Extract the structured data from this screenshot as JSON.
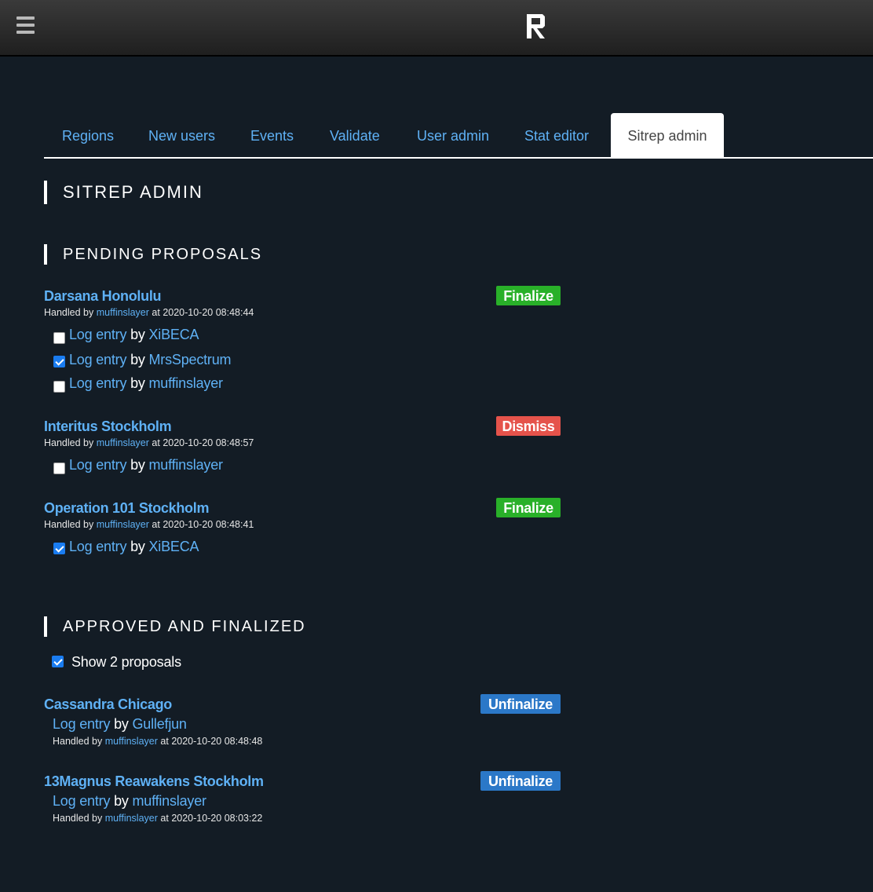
{
  "header": {
    "menu_icon": "hamburger-menu-icon",
    "logo_icon": "r-logo-icon"
  },
  "tabs": [
    {
      "label": "Regions"
    },
    {
      "label": "New users"
    },
    {
      "label": "Events"
    },
    {
      "label": "Validate"
    },
    {
      "label": "User admin"
    },
    {
      "label": "Stat editor"
    },
    {
      "label": "Sitrep admin",
      "active": true
    }
  ],
  "page_title": "SITREP ADMIN",
  "pending": {
    "heading": "PENDING PROPOSALS",
    "handled_by_prefix": "Handled by",
    "at_text": "at",
    "log_entry_label": "Log entry",
    "by_text": "by",
    "items": [
      {
        "title": "Darsana Honolulu",
        "handler": "muffinslayer",
        "timestamp": "2020-10-20 08:48:44",
        "action": "Finalize",
        "entries": [
          {
            "author": "XiBECA",
            "checked": false
          },
          {
            "author": "MrsSpectrum",
            "checked": true
          },
          {
            "author": "muffinslayer",
            "checked": false
          }
        ]
      },
      {
        "title": "Interitus Stockholm",
        "handler": "muffinslayer",
        "timestamp": "2020-10-20 08:48:57",
        "action": "Dismiss",
        "entries": [
          {
            "author": "muffinslayer",
            "checked": false
          }
        ]
      },
      {
        "title": "Operation 101 Stockholm",
        "handler": "muffinslayer",
        "timestamp": "2020-10-20 08:48:41",
        "action": "Finalize",
        "entries": [
          {
            "author": "XiBECA",
            "checked": true
          }
        ]
      }
    ]
  },
  "approved": {
    "heading": "APPROVED AND FINALIZED",
    "show_label": "Show 2 proposals",
    "show_checked": true,
    "items": [
      {
        "title": "Cassandra Chicago",
        "entry_author": "Gullefjun",
        "handler": "muffinslayer",
        "timestamp": "2020-10-20 08:48:48",
        "action": "Unfinalize"
      },
      {
        "title": "13Magnus Reawakens Stockholm",
        "entry_author": "muffinslayer",
        "handler": "muffinslayer",
        "timestamp": "2020-10-20 08:03:22",
        "action": "Unfinalize"
      }
    ]
  },
  "colors": {
    "background": "#131c25",
    "link": "#5fb1f5",
    "finalize": "#29b029",
    "dismiss": "#e5534b",
    "unfinalize": "#2b78c8"
  }
}
